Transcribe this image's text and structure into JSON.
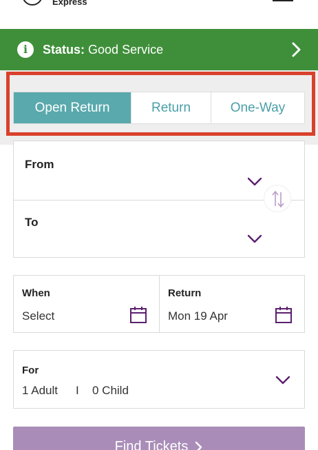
{
  "header": {
    "logo_text": "Express"
  },
  "status_bar": {
    "label": "Status:",
    "value": "Good Service",
    "info_icon": "info-icon",
    "color": "#3f8f3a"
  },
  "trip_tabs": {
    "items": [
      {
        "label": "Open Return",
        "active": true
      },
      {
        "label": "Return",
        "active": false
      },
      {
        "label": "One-Way",
        "active": false
      }
    ],
    "accent_color": "#59a9ad",
    "highlight_color": "#d9412c"
  },
  "route": {
    "from_label": "From",
    "to_label": "To",
    "swap_icon": "swap-vertical-icon"
  },
  "dates": {
    "when_label": "When",
    "when_value": "Select",
    "return_label": "Return",
    "return_value": "Mon 19 Apr"
  },
  "passengers": {
    "label": "For",
    "adults": "1 Adult",
    "separator": "I",
    "children": "0 Child"
  },
  "find_button": {
    "label": "Find Tickets",
    "color": "#a98db8"
  }
}
